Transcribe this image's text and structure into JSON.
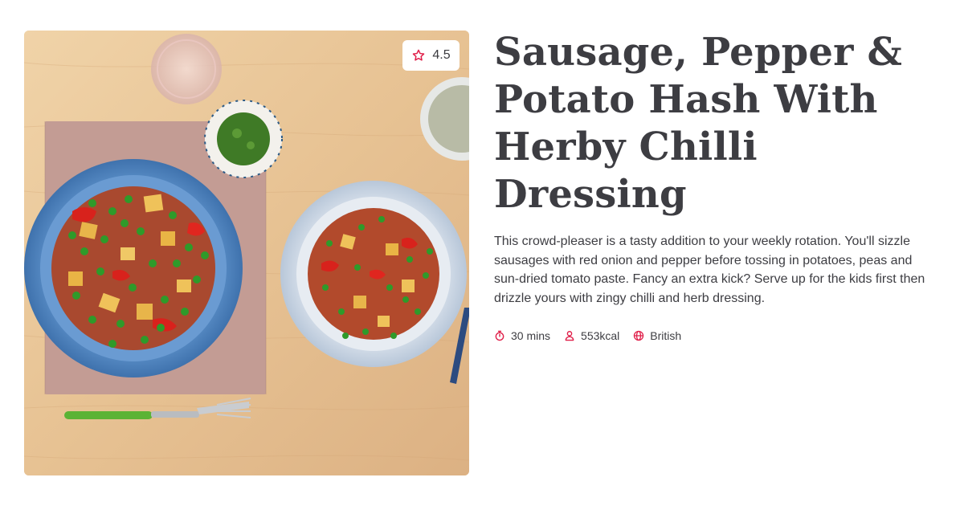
{
  "recipe": {
    "title": "Sausage, Pepper & Potato Hash With Herby Chilli Dressing",
    "description": "This crowd-pleaser is a tasty addition to your weekly rotation. You'll sizzle sausages with red onion and pepper before tossing in potatoes, peas and sun-dried tomato paste. Fancy an extra kick? Serve up for the kids first then drizzle yours with zingy chilli and herb dressing.",
    "rating": "4.5",
    "meta": {
      "time": "30 mins",
      "calories": "553kcal",
      "cuisine": "British"
    }
  },
  "icons": {
    "rating": "star-icon",
    "time": "stopwatch-icon",
    "calories": "person-icon",
    "cuisine": "globe-icon"
  },
  "colors": {
    "accent": "#e0204a",
    "text": "#3d3d42",
    "background": "#ffffff"
  }
}
